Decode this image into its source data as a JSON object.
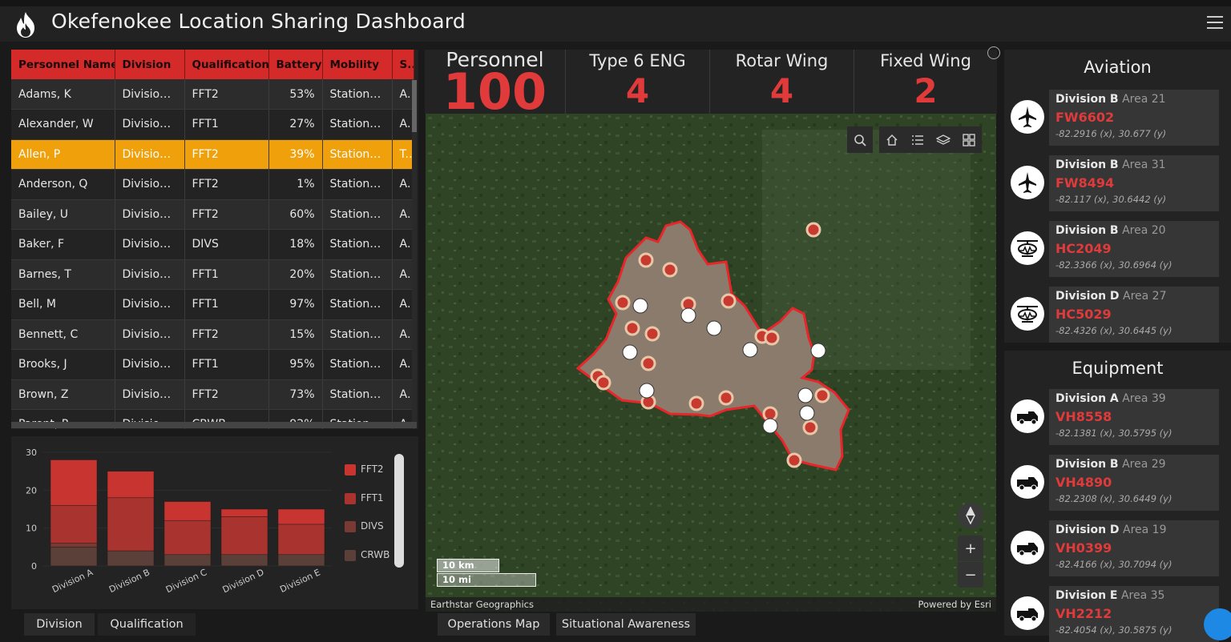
{
  "app": {
    "title": "Okefenokee Location Sharing Dashboard"
  },
  "table": {
    "columns": [
      "Personnel Name",
      "Division",
      "Qualification",
      "Battery",
      "Mobility",
      "S..."
    ],
    "rows": [
      [
        "Adams, K",
        "Division C",
        "FFT2",
        "53%",
        "Stationary",
        "A..."
      ],
      [
        "Alexander, W",
        "Division A",
        "FFT1",
        "27%",
        "Stationary",
        "A..."
      ],
      [
        "Allen, P",
        "Division C",
        "FFT2",
        "39%",
        "Stationary",
        "T..."
      ],
      [
        "Anderson, Q",
        "Division A",
        "FFT2",
        "1%",
        "Stationary",
        "A..."
      ],
      [
        "Bailey, U",
        "Division B",
        "FFT2",
        "60%",
        "Stationary",
        "A..."
      ],
      [
        "Baker, F",
        "Division D",
        "DIVS",
        "18%",
        "Stationary",
        "A..."
      ],
      [
        "Barnes, T",
        "Division D",
        "FFT1",
        "20%",
        "Stationary",
        "A..."
      ],
      [
        "Bell, M",
        "Division B",
        "FFT1",
        "97%",
        "Stationary",
        "A..."
      ],
      [
        "Bennett, C",
        "Division B",
        "FFT2",
        "15%",
        "Stationary",
        "A..."
      ],
      [
        "Brooks, J",
        "Division B",
        "FFT1",
        "95%",
        "Stationary",
        "A..."
      ],
      [
        "Brown, Z",
        "Division A",
        "FFT2",
        "73%",
        "Stationary",
        "A..."
      ],
      [
        "Parent, P",
        "Division A",
        "CRWB",
        "92%",
        "Stationary",
        "A..."
      ]
    ],
    "selected_index": 2
  },
  "chart_data": {
    "type": "bar",
    "stacked": true,
    "categories": [
      "Division A",
      "Division B",
      "Division C",
      "Division D",
      "Division E"
    ],
    "series": [
      {
        "name": "CRWB",
        "values": [
          5,
          4,
          3,
          3,
          3
        ],
        "color": "#5a4038"
      },
      {
        "name": "DIVS",
        "values": [
          1,
          0,
          0,
          0,
          0
        ],
        "color": "#7a3a34"
      },
      {
        "name": "FFT1",
        "values": [
          10,
          14,
          9,
          10,
          8
        ],
        "color": "#a8332f"
      },
      {
        "name": "FFT2",
        "values": [
          12,
          7,
          5,
          2,
          4
        ],
        "color": "#c83530"
      }
    ],
    "legend_order": [
      "FFT2",
      "FFT1",
      "DIVS",
      "CRWB"
    ],
    "yticks": [
      0,
      10,
      20,
      30
    ],
    "ylim": [
      0,
      30
    ]
  },
  "tabs_left": [
    "Division",
    "Qualification"
  ],
  "tabs_center": [
    "Operations Map",
    "Situational Awareness"
  ],
  "counters": [
    {
      "label": "Personnel",
      "value": "100"
    },
    {
      "label": "Type 6 ENG",
      "value": "4"
    },
    {
      "label": "Rotar Wing",
      "value": "4"
    },
    {
      "label": "Fixed Wing",
      "value": "2"
    }
  ],
  "map": {
    "scale_km": "10 km",
    "scale_mi": "10 mi",
    "attribution_left": "Earthstar Geographics",
    "attribution_right": "Powered by Esri",
    "toolbar": [
      "search-icon",
      "home-icon",
      "list-icon",
      "layers-icon",
      "qr-icon"
    ],
    "colors": {
      "perimeter": "#e8262a",
      "burn_area": "#8a7b6c",
      "forest": "#2f4626"
    }
  },
  "aviation": {
    "title": "Aviation",
    "cards": [
      {
        "division": "Division B",
        "area": "Area 21",
        "id": "FW6602",
        "coords": "-82.2916 (x), 30.677 (y)",
        "icon": "plane-icon"
      },
      {
        "division": "Division B",
        "area": "Area 31",
        "id": "FW8494",
        "coords": "-82.117 (x), 30.6442 (y)",
        "icon": "plane-icon"
      },
      {
        "division": "Division B",
        "area": "Area 20",
        "id": "HC2049",
        "coords": "-82.3366 (x), 30.6964 (y)",
        "icon": "helicopter-icon"
      },
      {
        "division": "Division D",
        "area": "Area 27",
        "id": "HC5029",
        "coords": "-82.4326 (x), 30.6445 (y)",
        "icon": "helicopter-icon"
      }
    ]
  },
  "equipment": {
    "title": "Equipment",
    "cards": [
      {
        "division": "Division A",
        "area": "Area 39",
        "id": "VH8558",
        "coords": "-82.1381 (x), 30.5795 (y)",
        "icon": "truck-icon"
      },
      {
        "division": "Division B",
        "area": "Area 29",
        "id": "VH4890",
        "coords": "-82.2308 (x), 30.6449 (y)",
        "icon": "truck-icon"
      },
      {
        "division": "Division D",
        "area": "Area 19",
        "id": "VH0399",
        "coords": "-82.4166 (x), 30.7094 (y)",
        "icon": "truck-icon"
      },
      {
        "division": "Division E",
        "area": "Area 35",
        "id": "VH2212",
        "coords": "-82.4054 (x), 30.5875 (y)",
        "icon": "truck-icon"
      }
    ]
  }
}
